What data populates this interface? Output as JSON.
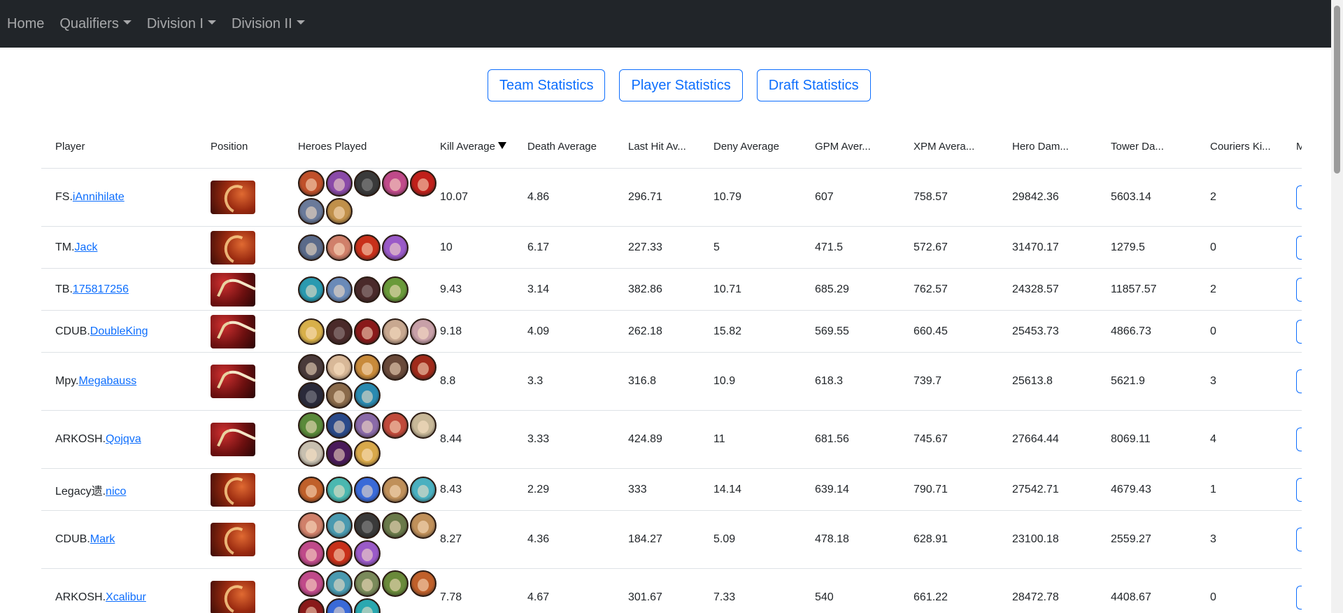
{
  "nav": {
    "items": [
      {
        "label": "Home",
        "dropdown": false
      },
      {
        "label": "Qualifiers",
        "dropdown": true
      },
      {
        "label": "Division I",
        "dropdown": true
      },
      {
        "label": "Division II",
        "dropdown": true
      }
    ]
  },
  "buttons": {
    "team": "Team Statistics",
    "player": "Player Statistics",
    "draft": "Draft Statistics"
  },
  "table": {
    "headers": [
      "Player",
      "Position",
      "Heroes Played",
      "Kill Average",
      "Death Average",
      "Last Hit Av...",
      "Deny Average",
      "GPM Aver...",
      "XPM Avera...",
      "Hero Dam...",
      "Tower Da...",
      "Couriers Ki...",
      "M"
    ],
    "sorted_column": "Kill Average",
    "rows": [
      {
        "team": "FS.",
        "player": "iAnnihilate",
        "position": "core",
        "heroes": [
          "#c0502a",
          "#8a4aa8",
          "#3a3a3a",
          "#c04a8a",
          "#c0201a",
          "#6a7a9a",
          "#c0904a"
        ],
        "kill": "10.07",
        "death": "4.86",
        "lasthit": "296.71",
        "deny": "10.79",
        "gpm": "607",
        "xpm": "758.57",
        "herodmg": "29842.36",
        "towerdmg": "5603.14",
        "couriers": "2"
      },
      {
        "team": "TM.",
        "player": "Jack",
        "position": "core",
        "heroes": [
          "#5a6a8a",
          "#d0806a",
          "#c8301a",
          "#9a5ac8"
        ],
        "kill": "10",
        "death": "6.17",
        "lasthit": "227.33",
        "deny": "5",
        "gpm": "471.5",
        "xpm": "572.67",
        "herodmg": "31470.17",
        "towerdmg": "1279.5",
        "couriers": "0"
      },
      {
        "team": "TB.",
        "player": "175817256",
        "position": "support",
        "heroes": [
          "#2a9ab0",
          "#6a8ab8",
          "#4a2a2a",
          "#6a9a3a"
        ],
        "kill": "9.43",
        "death": "3.14",
        "lasthit": "382.86",
        "deny": "10.71",
        "gpm": "685.29",
        "xpm": "762.57",
        "herodmg": "24328.57",
        "towerdmg": "11857.57",
        "couriers": "2"
      },
      {
        "team": "CDUB.",
        "player": "DoubleKing",
        "position": "support",
        "heroes": [
          "#d8b04a",
          "#4a2a2a",
          "#8a1a1a",
          "#c8a890",
          "#c8a0a8"
        ],
        "kill": "9.18",
        "death": "4.09",
        "lasthit": "262.18",
        "deny": "15.82",
        "gpm": "569.55",
        "xpm": "660.45",
        "herodmg": "25453.73",
        "towerdmg": "4866.73",
        "couriers": "0"
      },
      {
        "team": "Mpy.",
        "player": "Megabauss",
        "position": "support",
        "heroes": [
          "#4a3a3a",
          "#d8b898",
          "#c88a3a",
          "#6a4a3a",
          "#a02a1a",
          "#2a2a3a",
          "#8a6a4a",
          "#2a8ab0"
        ],
        "kill": "8.8",
        "death": "3.3",
        "lasthit": "316.8",
        "deny": "10.9",
        "gpm": "618.3",
        "xpm": "739.7",
        "herodmg": "25613.8",
        "towerdmg": "5621.9",
        "couriers": "3"
      },
      {
        "team": "ARKOSH.",
        "player": "Qojqva",
        "position": "support",
        "heroes": [
          "#5a8a3a",
          "#2a4a8a",
          "#8a6aa8",
          "#c04a3a",
          "#c8b898",
          "#c8c0b0",
          "#4a1a5a",
          "#d8a84a"
        ],
        "kill": "8.44",
        "death": "3.33",
        "lasthit": "424.89",
        "deny": "11",
        "gpm": "681.56",
        "xpm": "745.67",
        "herodmg": "27664.44",
        "towerdmg": "8069.11",
        "couriers": "4"
      },
      {
        "team": "Legacy遗.",
        "player": "nico",
        "position": "core",
        "heroes": [
          "#c0602a",
          "#4ab8b0",
          "#3a6ad8",
          "#c0905a",
          "#4ab0c0"
        ],
        "kill": "8.43",
        "death": "2.29",
        "lasthit": "333",
        "deny": "14.14",
        "gpm": "639.14",
        "xpm": "790.71",
        "herodmg": "27542.71",
        "towerdmg": "4679.43",
        "couriers": "1"
      },
      {
        "team": "CDUB.",
        "player": "Mark",
        "position": "core",
        "heroes": [
          "#d0806a",
          "#4a9ab0",
          "#3a3a3a",
          "#6a7a4a",
          "#c0905a",
          "#c04a8a",
          "#c8301a",
          "#9a5ac8"
        ],
        "kill": "8.27",
        "death": "4.36",
        "lasthit": "184.27",
        "deny": "5.09",
        "gpm": "478.18",
        "xpm": "628.91",
        "herodmg": "23100.18",
        "towerdmg": "2559.27",
        "couriers": "3"
      },
      {
        "team": "ARKOSH.",
        "player": "Xcalibur",
        "position": "core",
        "heroes": [
          "#c04a8a",
          "#4a9ab0",
          "#7a8a5a",
          "#6a8a3a",
          "#c0602a",
          "#8a1a1a",
          "#3a6ad8",
          "#2aa8b0"
        ],
        "kill": "7.78",
        "death": "4.67",
        "lasthit": "301.67",
        "deny": "7.33",
        "gpm": "540",
        "xpm": "661.22",
        "herodmg": "28472.78",
        "towerdmg": "4408.67",
        "couriers": "0"
      }
    ]
  },
  "colors": {
    "navbar_bg": "#212529",
    "accent": "#0d6efd"
  }
}
